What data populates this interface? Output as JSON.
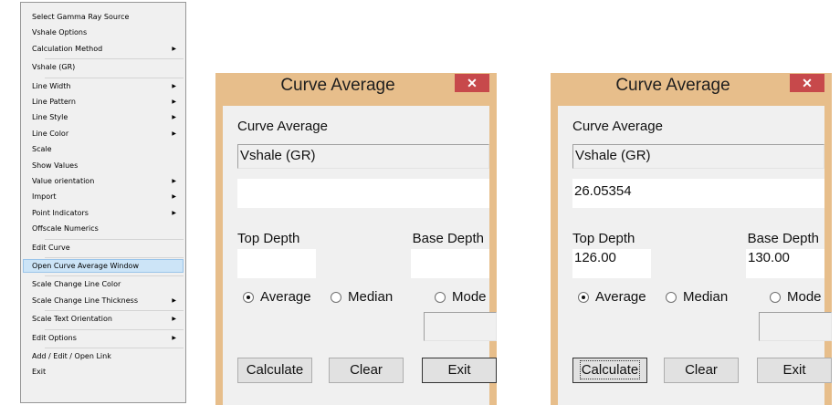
{
  "context_menu": {
    "items": [
      {
        "label": "Select Gamma Ray Source",
        "submenu": false
      },
      {
        "label": "Vshale Options",
        "submenu": false
      },
      {
        "label": "Calculation Method",
        "submenu": true
      },
      {
        "label": "Vshale (GR)",
        "submenu": false
      },
      {
        "label": "Line Width",
        "submenu": true
      },
      {
        "label": "Line Pattern",
        "submenu": true
      },
      {
        "label": "Line Style",
        "submenu": true
      },
      {
        "label": "Line Color",
        "submenu": true
      },
      {
        "label": "Scale",
        "submenu": false
      },
      {
        "label": "Show Values",
        "submenu": false
      },
      {
        "label": "Value orientation",
        "submenu": true
      },
      {
        "label": "Import",
        "submenu": true
      },
      {
        "label": "Point Indicators",
        "submenu": true
      },
      {
        "label": "Offscale Numerics",
        "submenu": false
      },
      {
        "label": "Edit Curve",
        "submenu": false
      },
      {
        "label": "Open Curve Average Window",
        "submenu": false,
        "highlighted": true
      },
      {
        "label": "Scale Change Line Color",
        "submenu": false
      },
      {
        "label": "Scale Change Line Thickness",
        "submenu": true
      },
      {
        "label": "Scale Text Orientation",
        "submenu": true
      },
      {
        "label": "Edit Options",
        "submenu": true
      },
      {
        "label": "Add / Edit / Open Link",
        "submenu": false
      },
      {
        "label": "Exit",
        "submenu": false
      }
    ]
  },
  "dialog_empty": {
    "title": "Curve Average",
    "close_symbol": "✕",
    "section_label": "Curve Average",
    "curve_name": "Vshale (GR)",
    "result": "",
    "top_depth_label": "Top Depth",
    "base_depth_label": "Base Depth",
    "top_depth": "",
    "base_depth": "",
    "radio_average": "Average",
    "radio_median": "Median",
    "radio_mode": "Mode",
    "selected": "Average",
    "calculate": "Calculate",
    "clear": "Clear",
    "exit": "Exit"
  },
  "dialog_filled": {
    "title": "Curve Average",
    "close_symbol": "✕",
    "section_label": "Curve Average",
    "curve_name": "Vshale (GR)",
    "result": "26.05354",
    "top_depth_label": "Top Depth",
    "base_depth_label": "Base Depth",
    "top_depth": "126.00",
    "base_depth": "130.00",
    "radio_average": "Average",
    "radio_median": "Median",
    "radio_mode": "Mode",
    "selected": "Average",
    "calculate": "Calculate",
    "clear": "Clear",
    "exit": "Exit"
  },
  "colors": {
    "dialog_frame": "#e7be8b",
    "close_button": "#c7494b",
    "menu_highlight": "#cce4f7"
  }
}
